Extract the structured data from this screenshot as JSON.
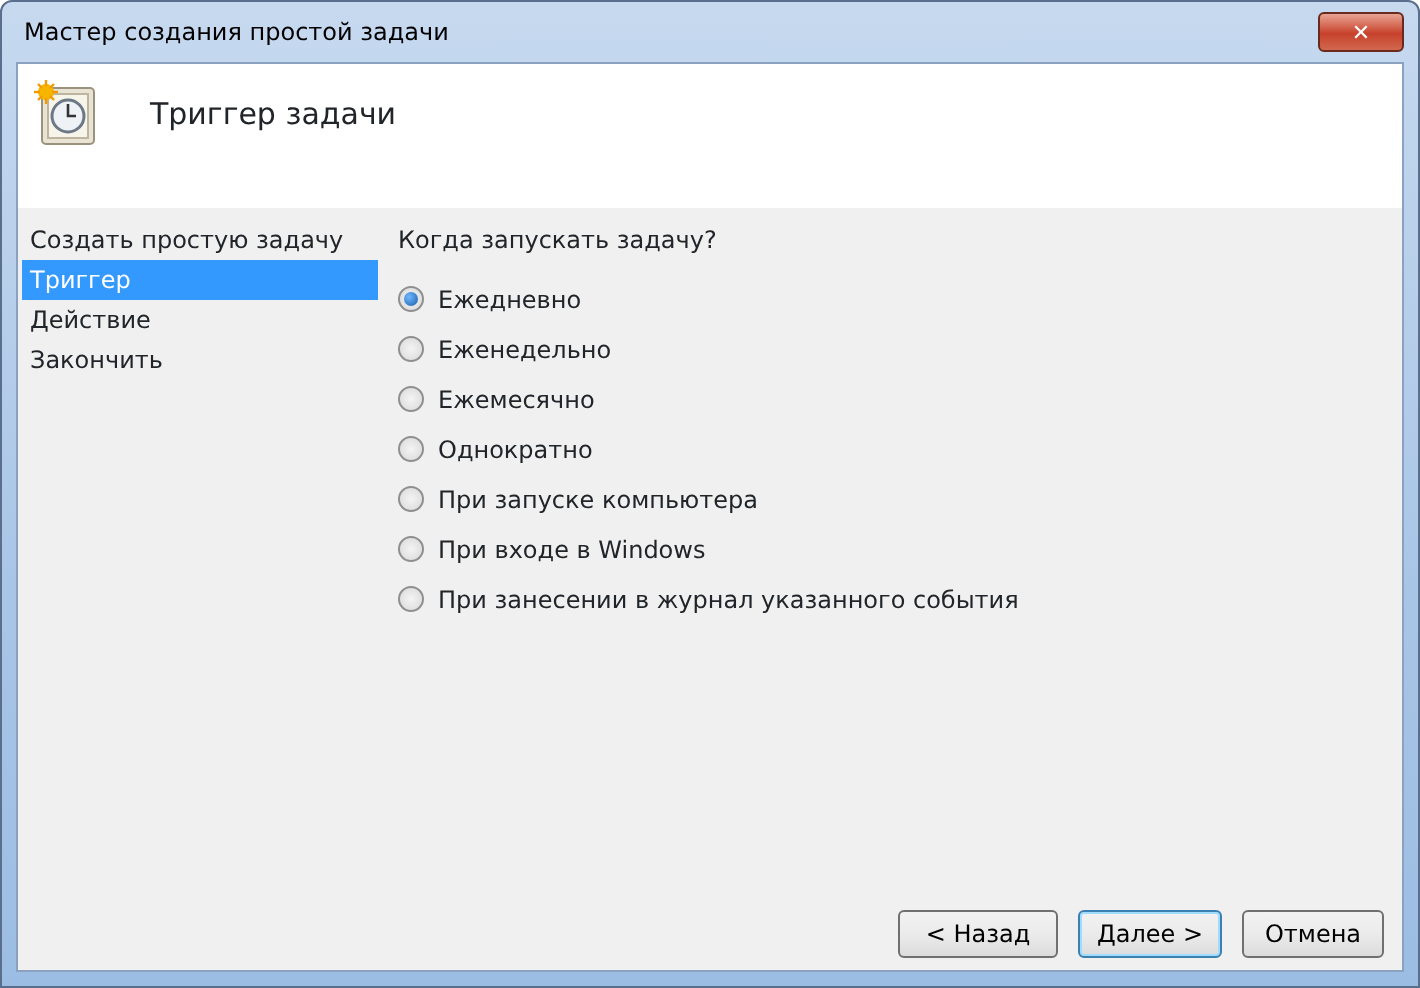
{
  "window": {
    "title": "Мастер создания простой задачи",
    "close": "✕"
  },
  "header": {
    "title": "Триггер задачи"
  },
  "steps": [
    {
      "label": "Создать простую задачу",
      "selected": false
    },
    {
      "label": "Триггер",
      "selected": true
    },
    {
      "label": "Действие",
      "selected": false
    },
    {
      "label": "Закончить",
      "selected": false
    }
  ],
  "question": "Когда запускать задачу?",
  "options": [
    {
      "label": "Ежедневно",
      "selected": true
    },
    {
      "label": "Еженедельно",
      "selected": false
    },
    {
      "label": "Ежемесячно",
      "selected": false
    },
    {
      "label": "Однократно",
      "selected": false
    },
    {
      "label": "При запуске компьютера",
      "selected": false
    },
    {
      "label": "При входе в Windows",
      "selected": false
    },
    {
      "label": "При занесении в журнал указанного события",
      "selected": false
    }
  ],
  "buttons": [
    {
      "label": "< Назад",
      "default": false
    },
    {
      "label": "Далее >",
      "default": true
    },
    {
      "label": "Отмена",
      "default": false
    }
  ]
}
